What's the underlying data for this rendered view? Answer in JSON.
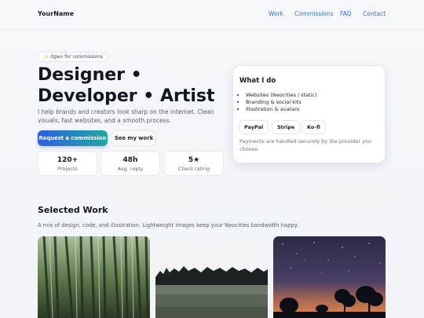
{
  "header": {
    "brand": "YourName",
    "nav": [
      "Work",
      "Commissions",
      "FAQ",
      "Contact"
    ]
  },
  "hero": {
    "badge": "✨ Open for commissions",
    "title": "Designer • Developer • Artist",
    "subtitle": "I help brands and creators look sharp on the internet. Clean visuals, fast websites, and a smooth process.",
    "primary_button": "Request a commission",
    "secondary_button": "See my work",
    "stats": [
      {
        "value": "120+",
        "label": "Projects"
      },
      {
        "value": "48h",
        "label": "Avg. reply"
      },
      {
        "value": "5★",
        "label": "Client rating"
      }
    ]
  },
  "card": {
    "title": "What I do",
    "items": [
      "Websites (Neocities / static)",
      "Branding & social kits",
      "Illustration & avatars"
    ],
    "payments": [
      "PayPal",
      "Stripe",
      "Ko-fi"
    ],
    "note": "Payments are handled securely by the provider you choose."
  },
  "work": {
    "title": "Selected Work",
    "subtitle": "A mix of design, code, and illustration. Lightweight images keep your Neocities bandwidth happy.",
    "thumbnails": [
      "bamboo-forest-image",
      "misty-treeline-field-image",
      "night-sky-trees-image"
    ]
  },
  "colors": {
    "link": "#2f6fd6",
    "primary_gradient_start": "#2f5fe0",
    "primary_gradient_end": "#1fa8a0"
  }
}
